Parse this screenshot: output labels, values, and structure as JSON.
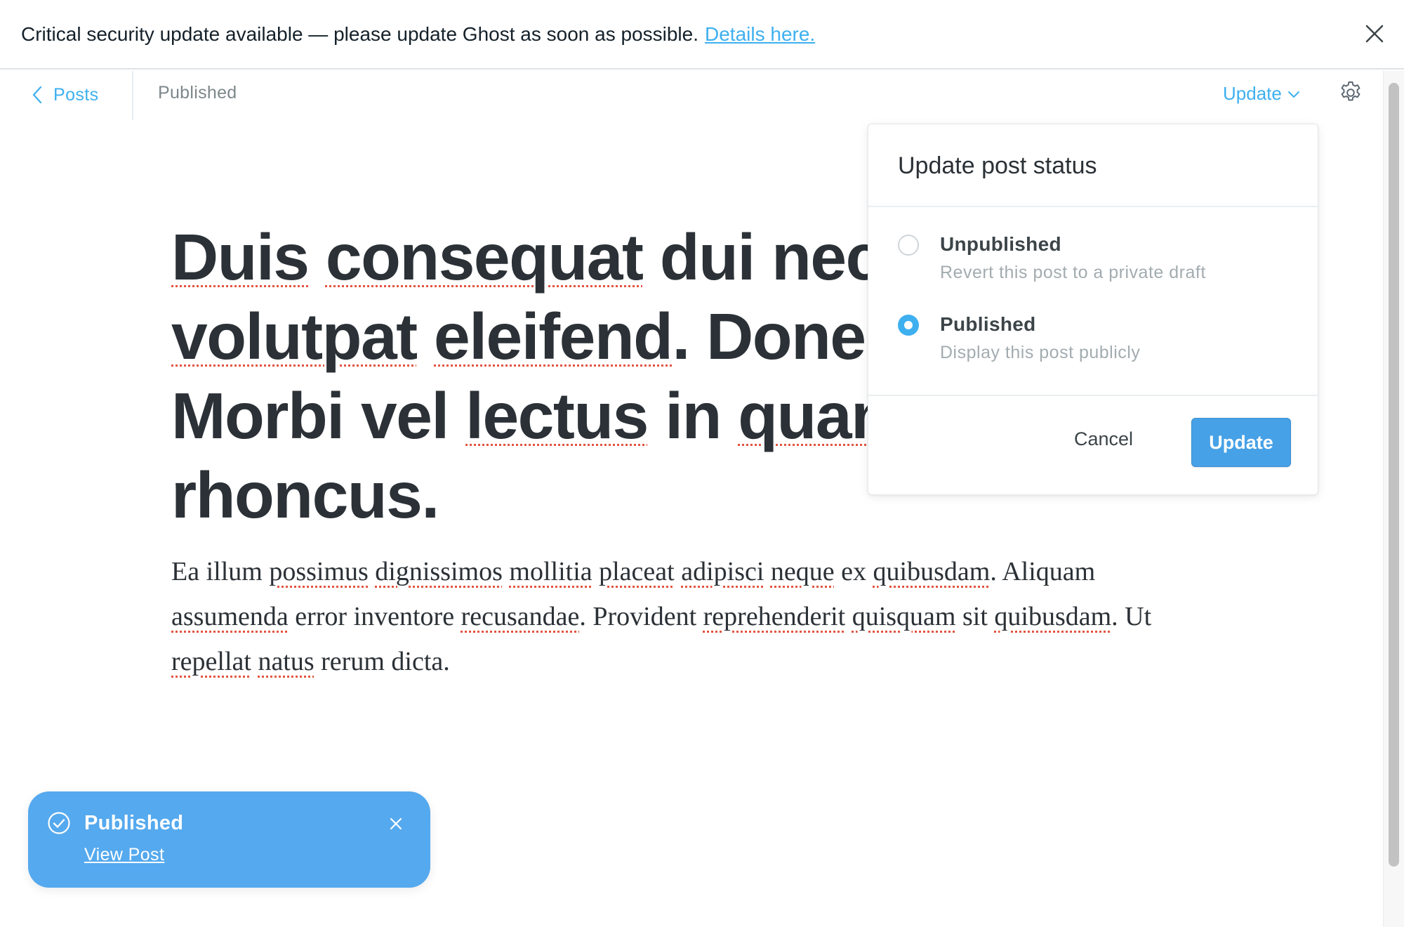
{
  "banner": {
    "message": "Critical security update available — please update Ghost as soon as possible.",
    "link_text": "Details here.",
    "close_icon": "close-icon"
  },
  "header": {
    "back_label": "Posts",
    "back_icon": "chevron-left-icon",
    "status": "Published",
    "update_trigger_label": "Update",
    "update_trigger_icon": "chevron-down-icon",
    "settings_icon": "gear-icon"
  },
  "post": {
    "title_lines": [
      "Duis consequat dui nec",
      "volutpat eleifend. Donec",
      "Morbi vel lectus in quam",
      "rhoncus."
    ],
    "body": "Ea illum possimus dignissimos mollitia placeat adipisci neque ex quibusdam. Aliquam assumenda error inventore recusandae. Provident reprehenderit quisquam sit quibusdam. Ut repellat natus rerum dicta."
  },
  "popover": {
    "title": "Update post status",
    "options": [
      {
        "label": "Unpublished",
        "description": "Revert this post to a private draft",
        "selected": false
      },
      {
        "label": "Published",
        "description": "Display this post publicly",
        "selected": true
      }
    ],
    "cancel_label": "Cancel",
    "confirm_label": "Update"
  },
  "toast": {
    "title": "Published",
    "link_text": "View Post",
    "icon": "check-circle-icon",
    "close_icon": "close-icon"
  },
  "colors": {
    "accent": "#3eb0ef",
    "toast_bg": "#55a9ee",
    "button_bg": "#46a1e6",
    "text": "#2b3136",
    "muted": "#a3acb0",
    "spellcheck": "#e25440"
  }
}
